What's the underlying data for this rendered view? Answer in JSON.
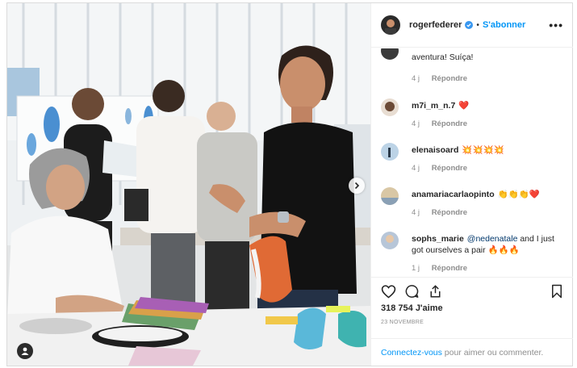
{
  "post": {
    "username": "rogerfederer",
    "follow_label": "S'abonner",
    "separator": "•",
    "more_label": "•••"
  },
  "comments": [
    {
      "user": "",
      "text": "de tenis do Federer. Tênis de corrida de aventura! Suíça!",
      "time": "4 j",
      "reply": "Répondre"
    },
    {
      "user": "m7i_m_n.7",
      "text": "❤️",
      "time": "4 j",
      "reply": "Répondre"
    },
    {
      "user": "elenaisoard",
      "text": "💥💥💥💥",
      "time": "4 j",
      "reply": "Répondre"
    },
    {
      "user": "anamariacarlaopinto",
      "text": "👏👏👏❤️",
      "time": "4 j",
      "reply": "Répondre"
    },
    {
      "user": "sophs_marie",
      "mention": "@nedenatale",
      "text": " and I just got ourselves a pair 🔥🔥🔥",
      "time": "1 j",
      "reply": "Répondre"
    }
  ],
  "stats": {
    "likes": "318 754 J'aime",
    "date": "23 NOVEMBRE"
  },
  "login": {
    "link": "Connectez-vous",
    "text": " pour aimer ou commenter."
  },
  "icons": {
    "like": "heart-icon",
    "comment": "comment-icon",
    "share": "share-icon",
    "save": "bookmark-icon",
    "next": "chevron-right-icon",
    "tag": "user-tag-icon",
    "verified": "verified-badge-icon"
  },
  "colors": {
    "accent": "#0095f6",
    "text": "#262626",
    "muted": "#8e8e8e",
    "border": "#efefef"
  }
}
